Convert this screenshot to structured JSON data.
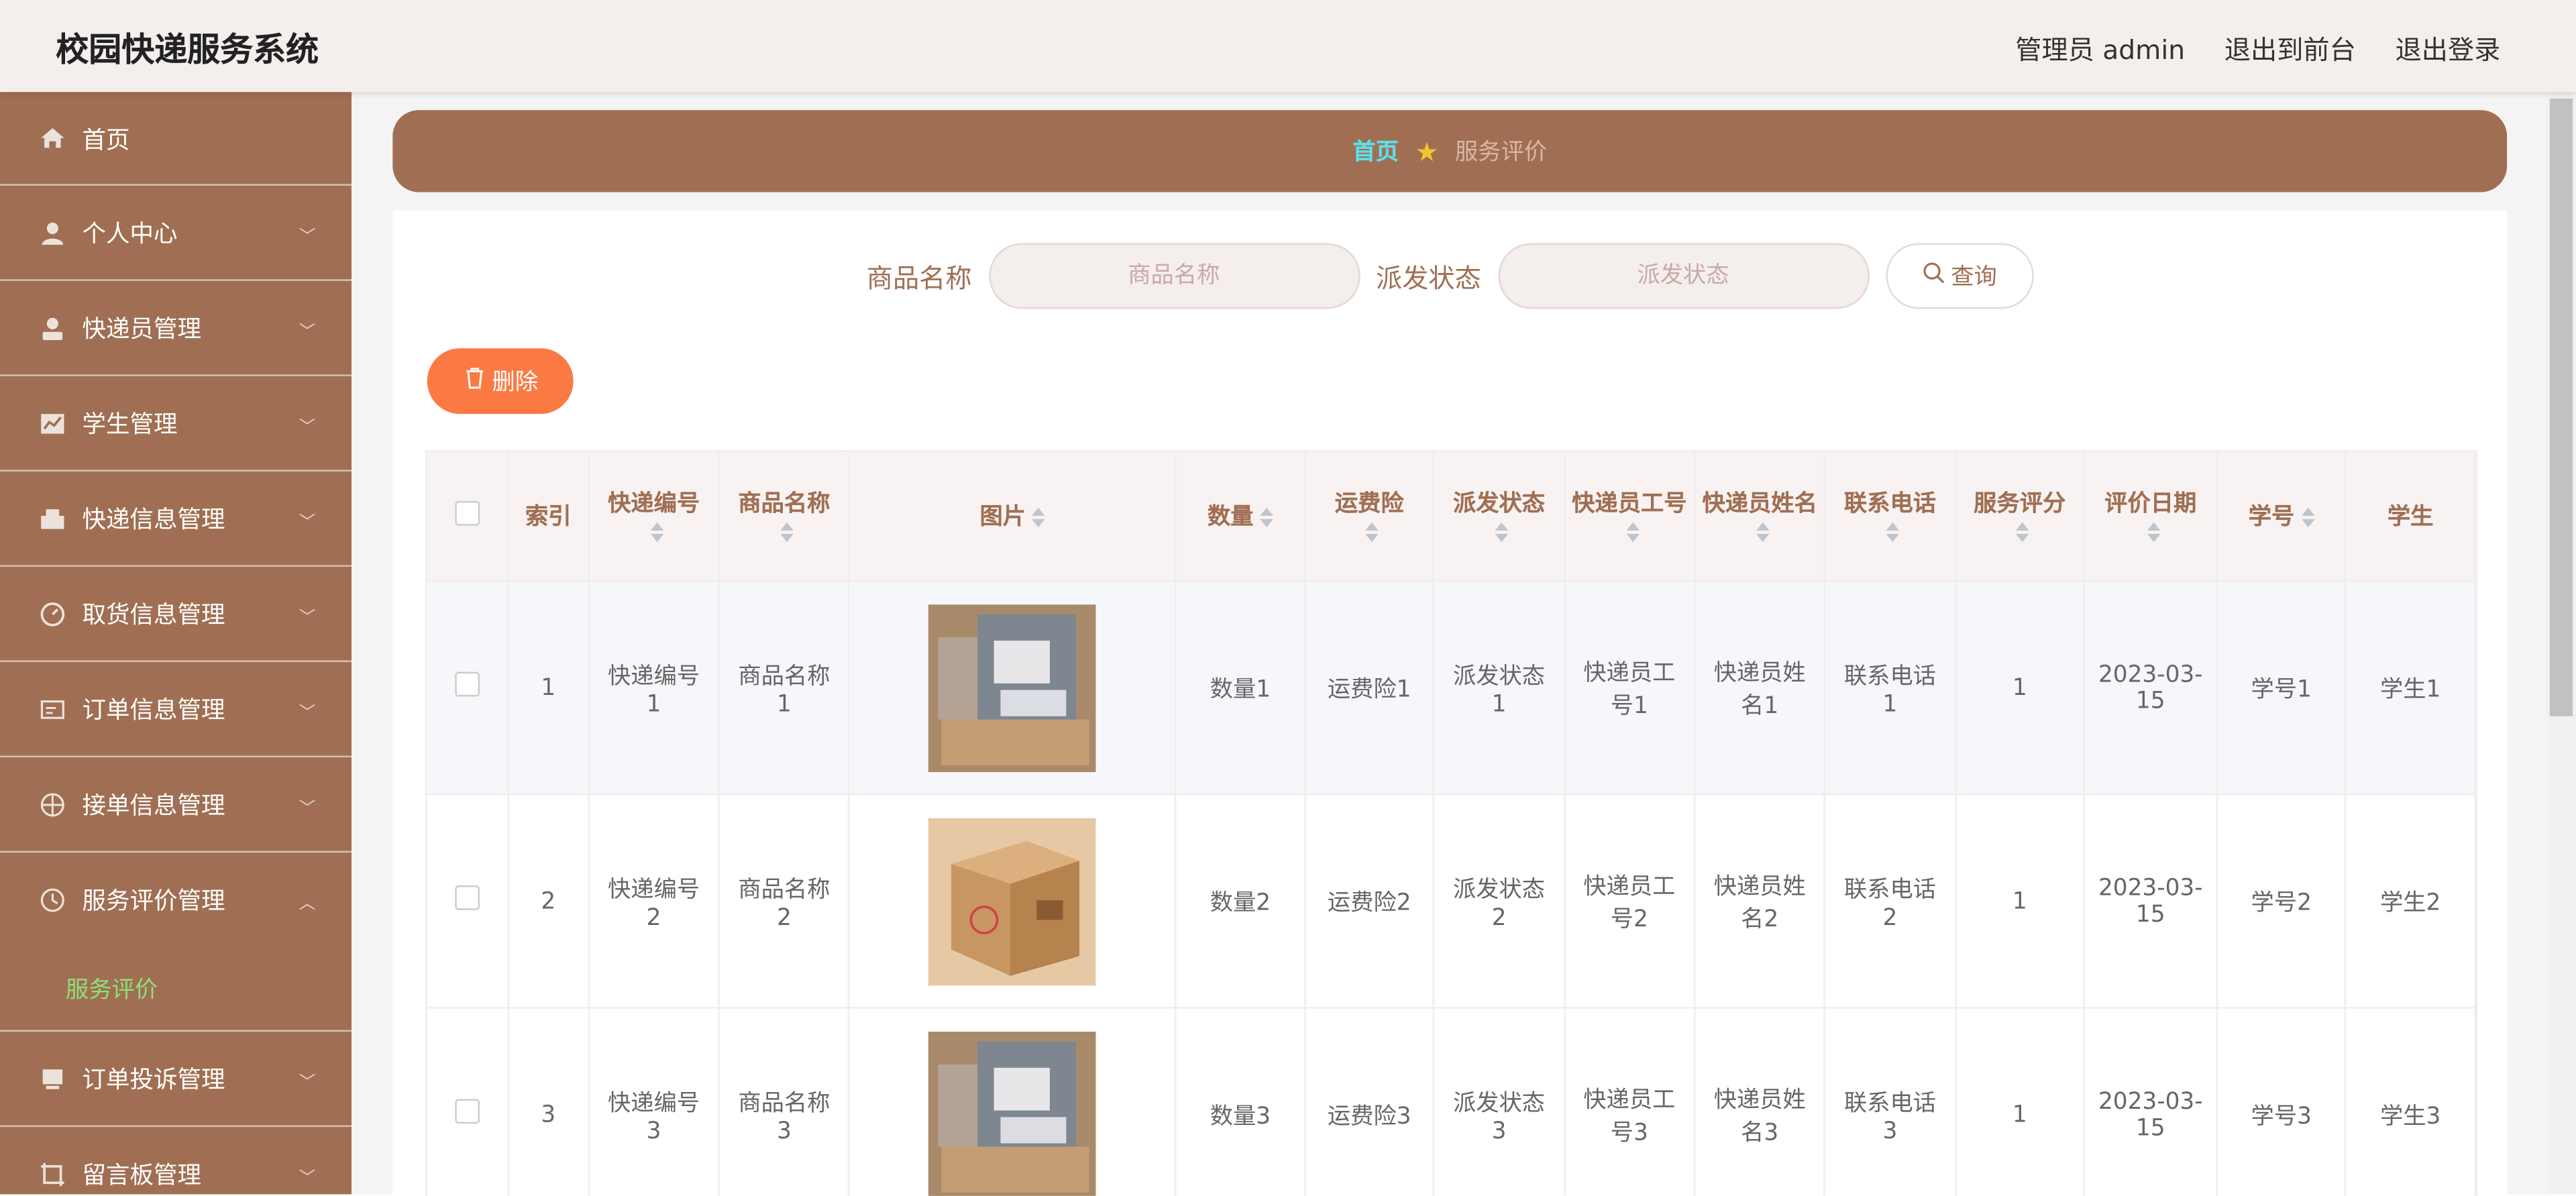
{
  "app_title": "校园快递服务系统",
  "top_links": {
    "admin": "管理员 admin",
    "front": "退出到前台",
    "logout": "退出登录"
  },
  "sidebar": {
    "items": [
      {
        "label": "首页",
        "icon": "home-icon"
      },
      {
        "label": "个人中心",
        "icon": "user-icon"
      },
      {
        "label": "快递员管理",
        "icon": "courier-icon"
      },
      {
        "label": "学生管理",
        "icon": "chart-icon"
      },
      {
        "label": "快递信息管理",
        "icon": "package-icon"
      },
      {
        "label": "取货信息管理",
        "icon": "pickup-icon"
      },
      {
        "label": "订单信息管理",
        "icon": "order-icon"
      },
      {
        "label": "接单信息管理",
        "icon": "target-icon"
      },
      {
        "label": "服务评价管理",
        "icon": "clock-icon"
      },
      {
        "label": "订单投诉管理",
        "icon": "complaint-icon"
      },
      {
        "label": "留言板管理",
        "icon": "message-icon"
      }
    ],
    "sub_item": "服务评价"
  },
  "breadcrumb": {
    "home": "首页",
    "current": "服务评价"
  },
  "search": {
    "label1": "商品名称",
    "placeholder1": "商品名称",
    "label2": "派发状态",
    "placeholder2": "派发状态",
    "button": "查询"
  },
  "delete_button": "删除",
  "table": {
    "headers": [
      "索引",
      "快递编号",
      "商品名称",
      "图片",
      "数量",
      "运费险",
      "派发状态",
      "快递员工号",
      "快递员姓名",
      "联系电话",
      "服务评分",
      "评价日期",
      "学号",
      "学生"
    ],
    "rows": [
      {
        "index": "1",
        "express_no": "快递编号1",
        "product": "商品名称1",
        "qty": "数量1",
        "insurance": "运费险1",
        "status": "派发状态1",
        "courier_id": "快递员工号1",
        "courier_name": "快递员姓名1",
        "phone": "联系电话1",
        "score": "1",
        "date": "2023-03-15",
        "student_no": "学号1",
        "student": "学生1",
        "image": "bag-photo"
      },
      {
        "index": "2",
        "express_no": "快递编号2",
        "product": "商品名称2",
        "qty": "数量2",
        "insurance": "运费险2",
        "status": "派发状态2",
        "courier_id": "快递员工号2",
        "courier_name": "快递员姓名2",
        "phone": "联系电话2",
        "score": "1",
        "date": "2023-03-15",
        "student_no": "学号2",
        "student": "学生2",
        "image": "box-photo"
      },
      {
        "index": "3",
        "express_no": "快递编号3",
        "product": "商品名称3",
        "qty": "数量3",
        "insurance": "运费险3",
        "status": "派发状态3",
        "courier_id": "快递员工号3",
        "courier_name": "快递员姓名3",
        "phone": "联系电话3",
        "score": "1",
        "date": "2023-03-15",
        "student_no": "学号3",
        "student": "学生3",
        "image": "bag-photo"
      }
    ]
  },
  "colors": {
    "sidebar": "#a06f53",
    "accent": "#fb7a44",
    "active_sub": "#8ee07a",
    "breadcrumb_home": "#5ce0ee"
  }
}
